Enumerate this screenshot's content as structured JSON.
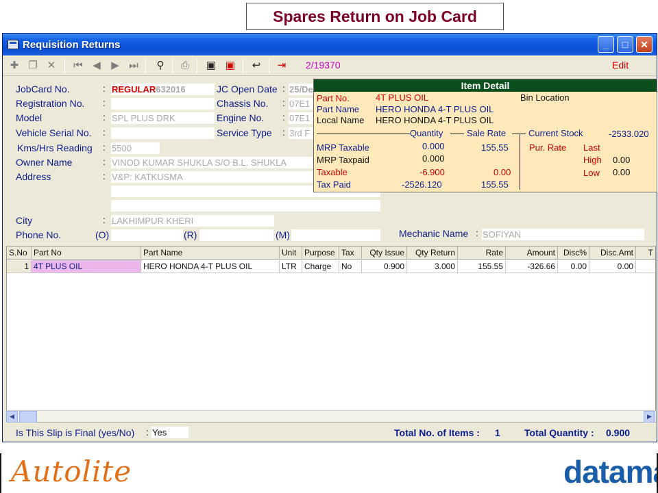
{
  "slide_title": "Spares Return on Job Card",
  "window": {
    "title": "Requisition Returns",
    "record_no": "2/19370",
    "mode": "Edit"
  },
  "toolbar": {
    "icons": [
      "add-icon",
      "copy-icon",
      "delete-icon",
      "first-record-icon",
      "prev-record-icon",
      "next-record-icon",
      "last-record-icon",
      "find-icon",
      "print-icon",
      "save-icon",
      "cancel-icon",
      "undo-icon",
      "exit-icon"
    ]
  },
  "form": {
    "jobcard_no": {
      "label": "JobCard No.",
      "prefix": "REGULAR",
      "value": "632016"
    },
    "jc_open_date": {
      "label": "JC Open Date",
      "value": "25/De"
    },
    "registration_no": {
      "label": "Registration No.",
      "value": ""
    },
    "chassis_no": {
      "label": "Chassis No.",
      "value": "07E1"
    },
    "model": {
      "label": "Model",
      "value": "SPL PLUS DRK"
    },
    "engine_no": {
      "label": "Engine No.",
      "value": "07E1"
    },
    "vehicle_serial_no": {
      "label": "Vehicle Serial No.",
      "value": ""
    },
    "service_type": {
      "label": "Service Type",
      "value": "3rd F"
    },
    "kms_hrs_reading": {
      "label": "Kms/Hrs Reading",
      "value": "5500"
    },
    "owner_name": {
      "label": "Owner Name",
      "value": "VINOD KUMAR SHUKLA S/O B.L. SHUKLA"
    },
    "address": {
      "label": "Address",
      "line1": "V&P: KATKUSMA",
      "line2": "",
      "line3": ""
    },
    "city": {
      "label": "City",
      "value": "LAKHIMPUR KHERI"
    },
    "phone": {
      "label": "Phone No.",
      "o_label": "(O)",
      "r_label": "(R)",
      "m_label": "(M)",
      "o": "",
      "r": "",
      "m": ""
    },
    "mechanic": {
      "label": "Mechanic Name",
      "value": "SOFIYAN"
    }
  },
  "item_detail": {
    "title": "Item Detail",
    "part_no_label": "Part No.",
    "part_no": "4T PLUS OIL",
    "part_name_label": "Part Name",
    "part_name": "HERO HONDA 4-T PLUS OIL",
    "local_name_label": "Local Name",
    "local_name": "HERO HONDA 4-T PLUS OIL",
    "bin_location_label": "Bin Location",
    "quantity_header": "Quantity",
    "sale_rate_header": "Sale Rate",
    "current_stock_label": "Current Stock",
    "current_stock": "-2533.020",
    "rows": [
      {
        "label": "MRP Taxable",
        "qty": "0.000",
        "rate": "155.55"
      },
      {
        "label": "MRP Taxpaid",
        "qty": "0.000",
        "rate": ""
      },
      {
        "label": "Taxable",
        "qty": "-6.900",
        "rate": "0.00"
      },
      {
        "label": "Tax Paid",
        "qty": "-2526.120",
        "rate": "155.55"
      }
    ],
    "pur_rate_label": "Pur. Rate",
    "last_label": "Last",
    "high_label": "High",
    "high": "0.00",
    "low_label": "Low",
    "low": "0.00"
  },
  "grid": {
    "columns": [
      "S.No",
      "Part No",
      "Part Name",
      "Unit",
      "Purpose",
      "Tax",
      "Qty Issue",
      "Qty Return",
      "Rate",
      "Amount",
      "Disc%",
      "Disc.Amt",
      "T"
    ],
    "rows": [
      {
        "sno": "1",
        "part_no": "4T PLUS OIL",
        "part_name": "HERO HONDA 4-T PLUS OIL",
        "unit": "LTR",
        "purpose": "Charge",
        "tax": "No",
        "qty_issue": "0.900",
        "qty_return": "3.000",
        "rate": "155.55",
        "amount": "-326.66",
        "disc_pct": "0.00",
        "disc_amt": "0.00",
        "t": ""
      }
    ]
  },
  "status": {
    "final_label": "Is This Slip is Final (yes/No)",
    "final_value": "Yes",
    "total_items_label": "Total No. of Items :",
    "total_items": "1",
    "total_qty_label": "Total Quantity :",
    "total_qty": "0.900"
  },
  "logos": {
    "left": "Autolite",
    "right": "dataman"
  }
}
